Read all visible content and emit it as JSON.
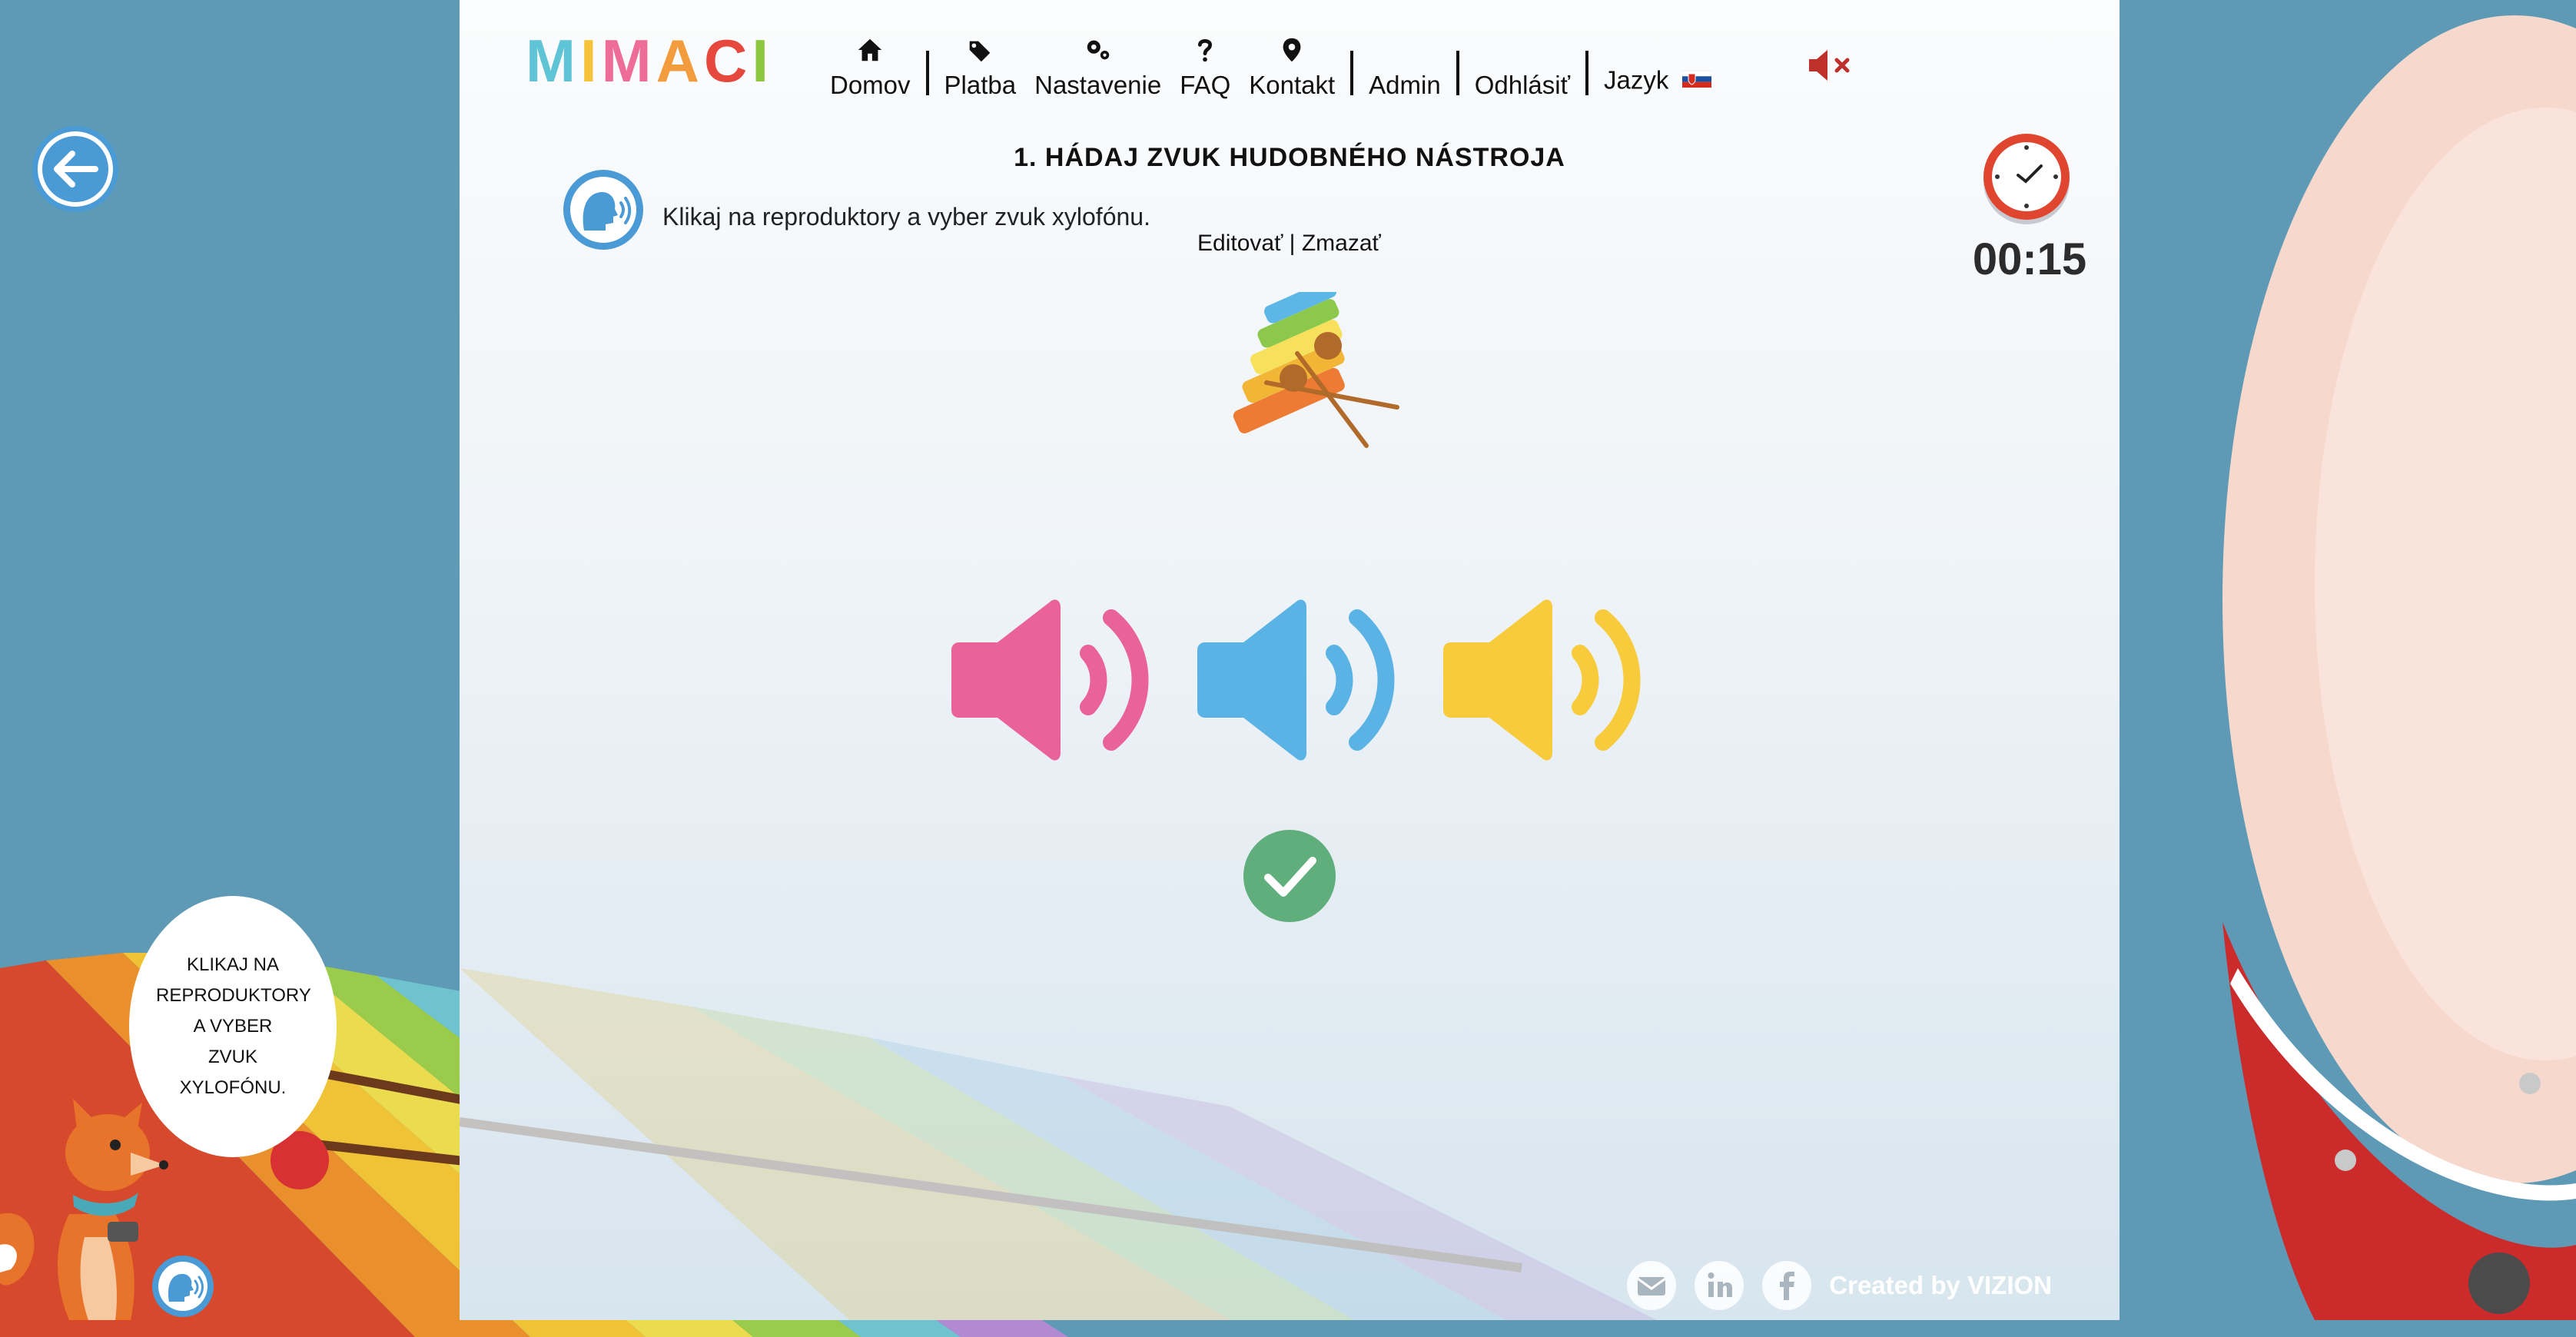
{
  "brand": {
    "logo_letters": [
      {
        "char": "M",
        "color": "#5ec4d6"
      },
      {
        "char": "I",
        "color": "#f4c33a"
      },
      {
        "char": "M",
        "color": "#ee6c98"
      },
      {
        "char": "A",
        "color": "#f39c3d"
      },
      {
        "char": "C",
        "color": "#e7483e"
      },
      {
        "char": "I",
        "color": "#8dc63f"
      }
    ]
  },
  "nav": {
    "home": {
      "label": "Domov",
      "icon": "home-icon"
    },
    "payment": {
      "label": "Platba",
      "icon": "tags-icon"
    },
    "settings": {
      "label": "Nastavenie",
      "icon": "gears-icon"
    },
    "faq": {
      "label": "FAQ",
      "icon": "question-icon"
    },
    "contact": {
      "label": "Kontakt",
      "icon": "map-pin-icon"
    },
    "admin": {
      "label": "Admin"
    },
    "logout": {
      "label": "Odhlásiť"
    },
    "language": {
      "label": "Jazyk",
      "flag": "slovak-flag-icon"
    },
    "sound": {
      "icon": "sound-muted-icon"
    }
  },
  "exercise": {
    "title": "1. HÁDAJ ZVUK HUDOBNÉHO NÁSTROJA",
    "instruction": "Klikaj na reproduktory a vyber zvuk xylofónu.",
    "edit_label": "Editovať",
    "separator": "|",
    "delete_label": "Zmazať",
    "timer": "00:15"
  },
  "options": [
    {
      "icon": "speaker-icon",
      "color": "#e9629a"
    },
    {
      "icon": "speaker-icon",
      "color": "#5ab3e4"
    },
    {
      "icon": "speaker-icon",
      "color": "#f8cb3c"
    }
  ],
  "mascot": {
    "bubble_lines": [
      "KLIKAJ NA",
      "REPRODUKTORY",
      "A VYBER",
      "ZVUK",
      "XYLOFÓNU."
    ]
  },
  "footer": {
    "credit": "Created by VIZION",
    "icons": [
      "email-icon",
      "linkedin-icon",
      "facebook-icon"
    ]
  },
  "colors": {
    "page_bg": "#5e9ab5",
    "accent_blue": "#4a9ad6",
    "check_green": "#5fae7c",
    "clock_red": "#e04530",
    "mute_red": "#c0302a"
  }
}
